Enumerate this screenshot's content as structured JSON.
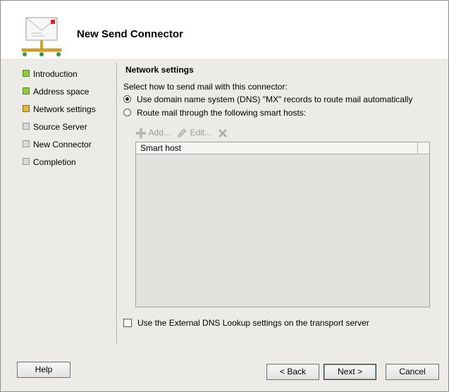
{
  "window": {
    "title": "New Send Connector"
  },
  "steps": [
    {
      "label": "Introduction",
      "state": "done"
    },
    {
      "label": "Address space",
      "state": "done"
    },
    {
      "label": "Network settings",
      "state": "current"
    },
    {
      "label": "Source Server",
      "state": "pending"
    },
    {
      "label": "New Connector",
      "state": "pending"
    },
    {
      "label": "Completion",
      "state": "pending"
    }
  ],
  "main": {
    "section_title": "Network settings",
    "instruction": "Select how to send mail with this connector:",
    "options": [
      {
        "label": "Use domain name system (DNS) \"MX\" records to route mail automatically",
        "checked": true
      },
      {
        "label": "Route mail through the following smart hosts:",
        "checked": false
      }
    ],
    "toolbar": {
      "add_label": "Add...",
      "edit_label": "Edit..."
    },
    "grid": {
      "columns": [
        "Smart host"
      ],
      "rows": []
    },
    "external_dns": {
      "label": "Use the External DNS Lookup settings on the transport server",
      "checked": false
    }
  },
  "buttons": {
    "help": "Help",
    "back": "< Back",
    "next": "Next >",
    "cancel": "Cancel"
  },
  "colors": {
    "step_done": "#8ccc3a",
    "step_current": "#e3b83a",
    "step_pending": "#d8d8d8",
    "panel_bg": "#ecebe7"
  }
}
